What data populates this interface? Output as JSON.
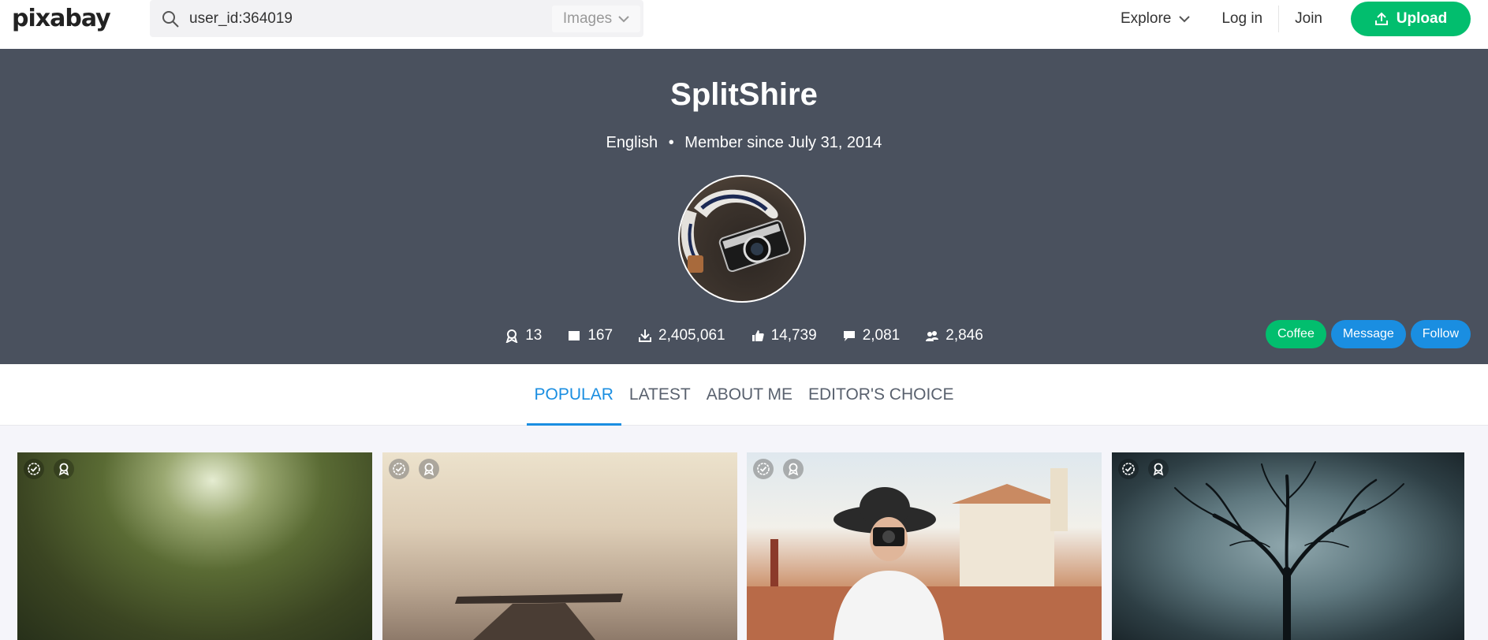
{
  "header": {
    "logo": "pixabay",
    "search": {
      "value": "user_id:364019",
      "type_label": "Images"
    },
    "nav": {
      "explore": "Explore",
      "login": "Log in",
      "join": "Join",
      "upload": "Upload"
    }
  },
  "profile": {
    "name": "SplitShire",
    "language": "English",
    "member_since": "Member since July 31, 2014",
    "stats": {
      "awards": "13",
      "images": "167",
      "downloads": "2,405,061",
      "likes": "14,739",
      "comments": "2,081",
      "followers": "2,846"
    },
    "actions": {
      "coffee": "Coffee",
      "message": "Message",
      "follow": "Follow"
    }
  },
  "tabs": [
    {
      "label": "POPULAR",
      "active": true
    },
    {
      "label": "LATEST",
      "active": false
    },
    {
      "label": "ABOUT ME",
      "active": false
    },
    {
      "label": "EDITOR'S CHOICE",
      "active": false
    }
  ],
  "colors": {
    "accent": "#1a8ee1",
    "brand_green": "#02be6e",
    "banner": "#4a515e"
  },
  "gallery": [
    {
      "subject": "forest path",
      "icons": [
        "checkmark-badge-icon",
        "award-icon"
      ]
    },
    {
      "subject": "pier in fog",
      "icons": [
        "checkmark-badge-icon",
        "award-icon"
      ]
    },
    {
      "subject": "woman with camera",
      "icons": [
        "checkmark-badge-icon",
        "award-icon"
      ]
    },
    {
      "subject": "bare tree",
      "icons": [
        "checkmark-badge-icon",
        "award-icon"
      ]
    }
  ]
}
